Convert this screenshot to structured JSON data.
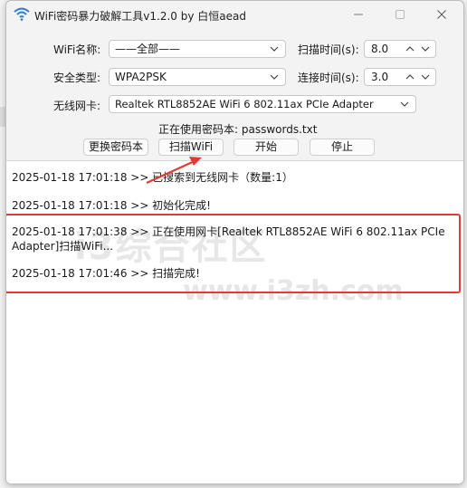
{
  "window": {
    "title": "WiFi密码暴力破解工具v1.2.0 by 白恒aead"
  },
  "form": {
    "wifi_name_label": "WiFi名称:",
    "wifi_name_value": "——全部——",
    "security_label": "安全类型:",
    "security_value": "WPA2PSK",
    "adapter_label": "无线网卡:",
    "adapter_value": "Realtek RTL8852AE WiFi 6 802.11ax PCIe Adapter",
    "scan_time_label": "扫描时间(s):",
    "scan_time_value": "8.0",
    "connect_time_label": "连接时间(s):",
    "connect_time_value": "3.0",
    "password_file_text": "正在使用密码本: passwords.txt"
  },
  "buttons": {
    "change_dict": "更换密码本",
    "scan_wifi": "扫描WiFi",
    "start": "开始",
    "stop": "停止"
  },
  "log": {
    "lines": [
      "2025-01-18 17:01:18 >> 已搜索到无线网卡（数量:1）",
      "2025-01-18 17:01:18 >> 初始化完成!",
      "2025-01-18 17:01:38 >> 正在使用网卡[Realtek RTL8852AE WiFi 6 802.11ax PCIe Adapter]扫描WiFi...",
      "2025-01-18 17:01:46 >> 扫描完成!"
    ]
  },
  "watermark": {
    "logo_text": "i3综合社区",
    "url": "www.i3zh.com"
  },
  "colors": {
    "highlight": "#e53935",
    "background": "#f3f3f3",
    "log_bg": "#ffffff"
  }
}
